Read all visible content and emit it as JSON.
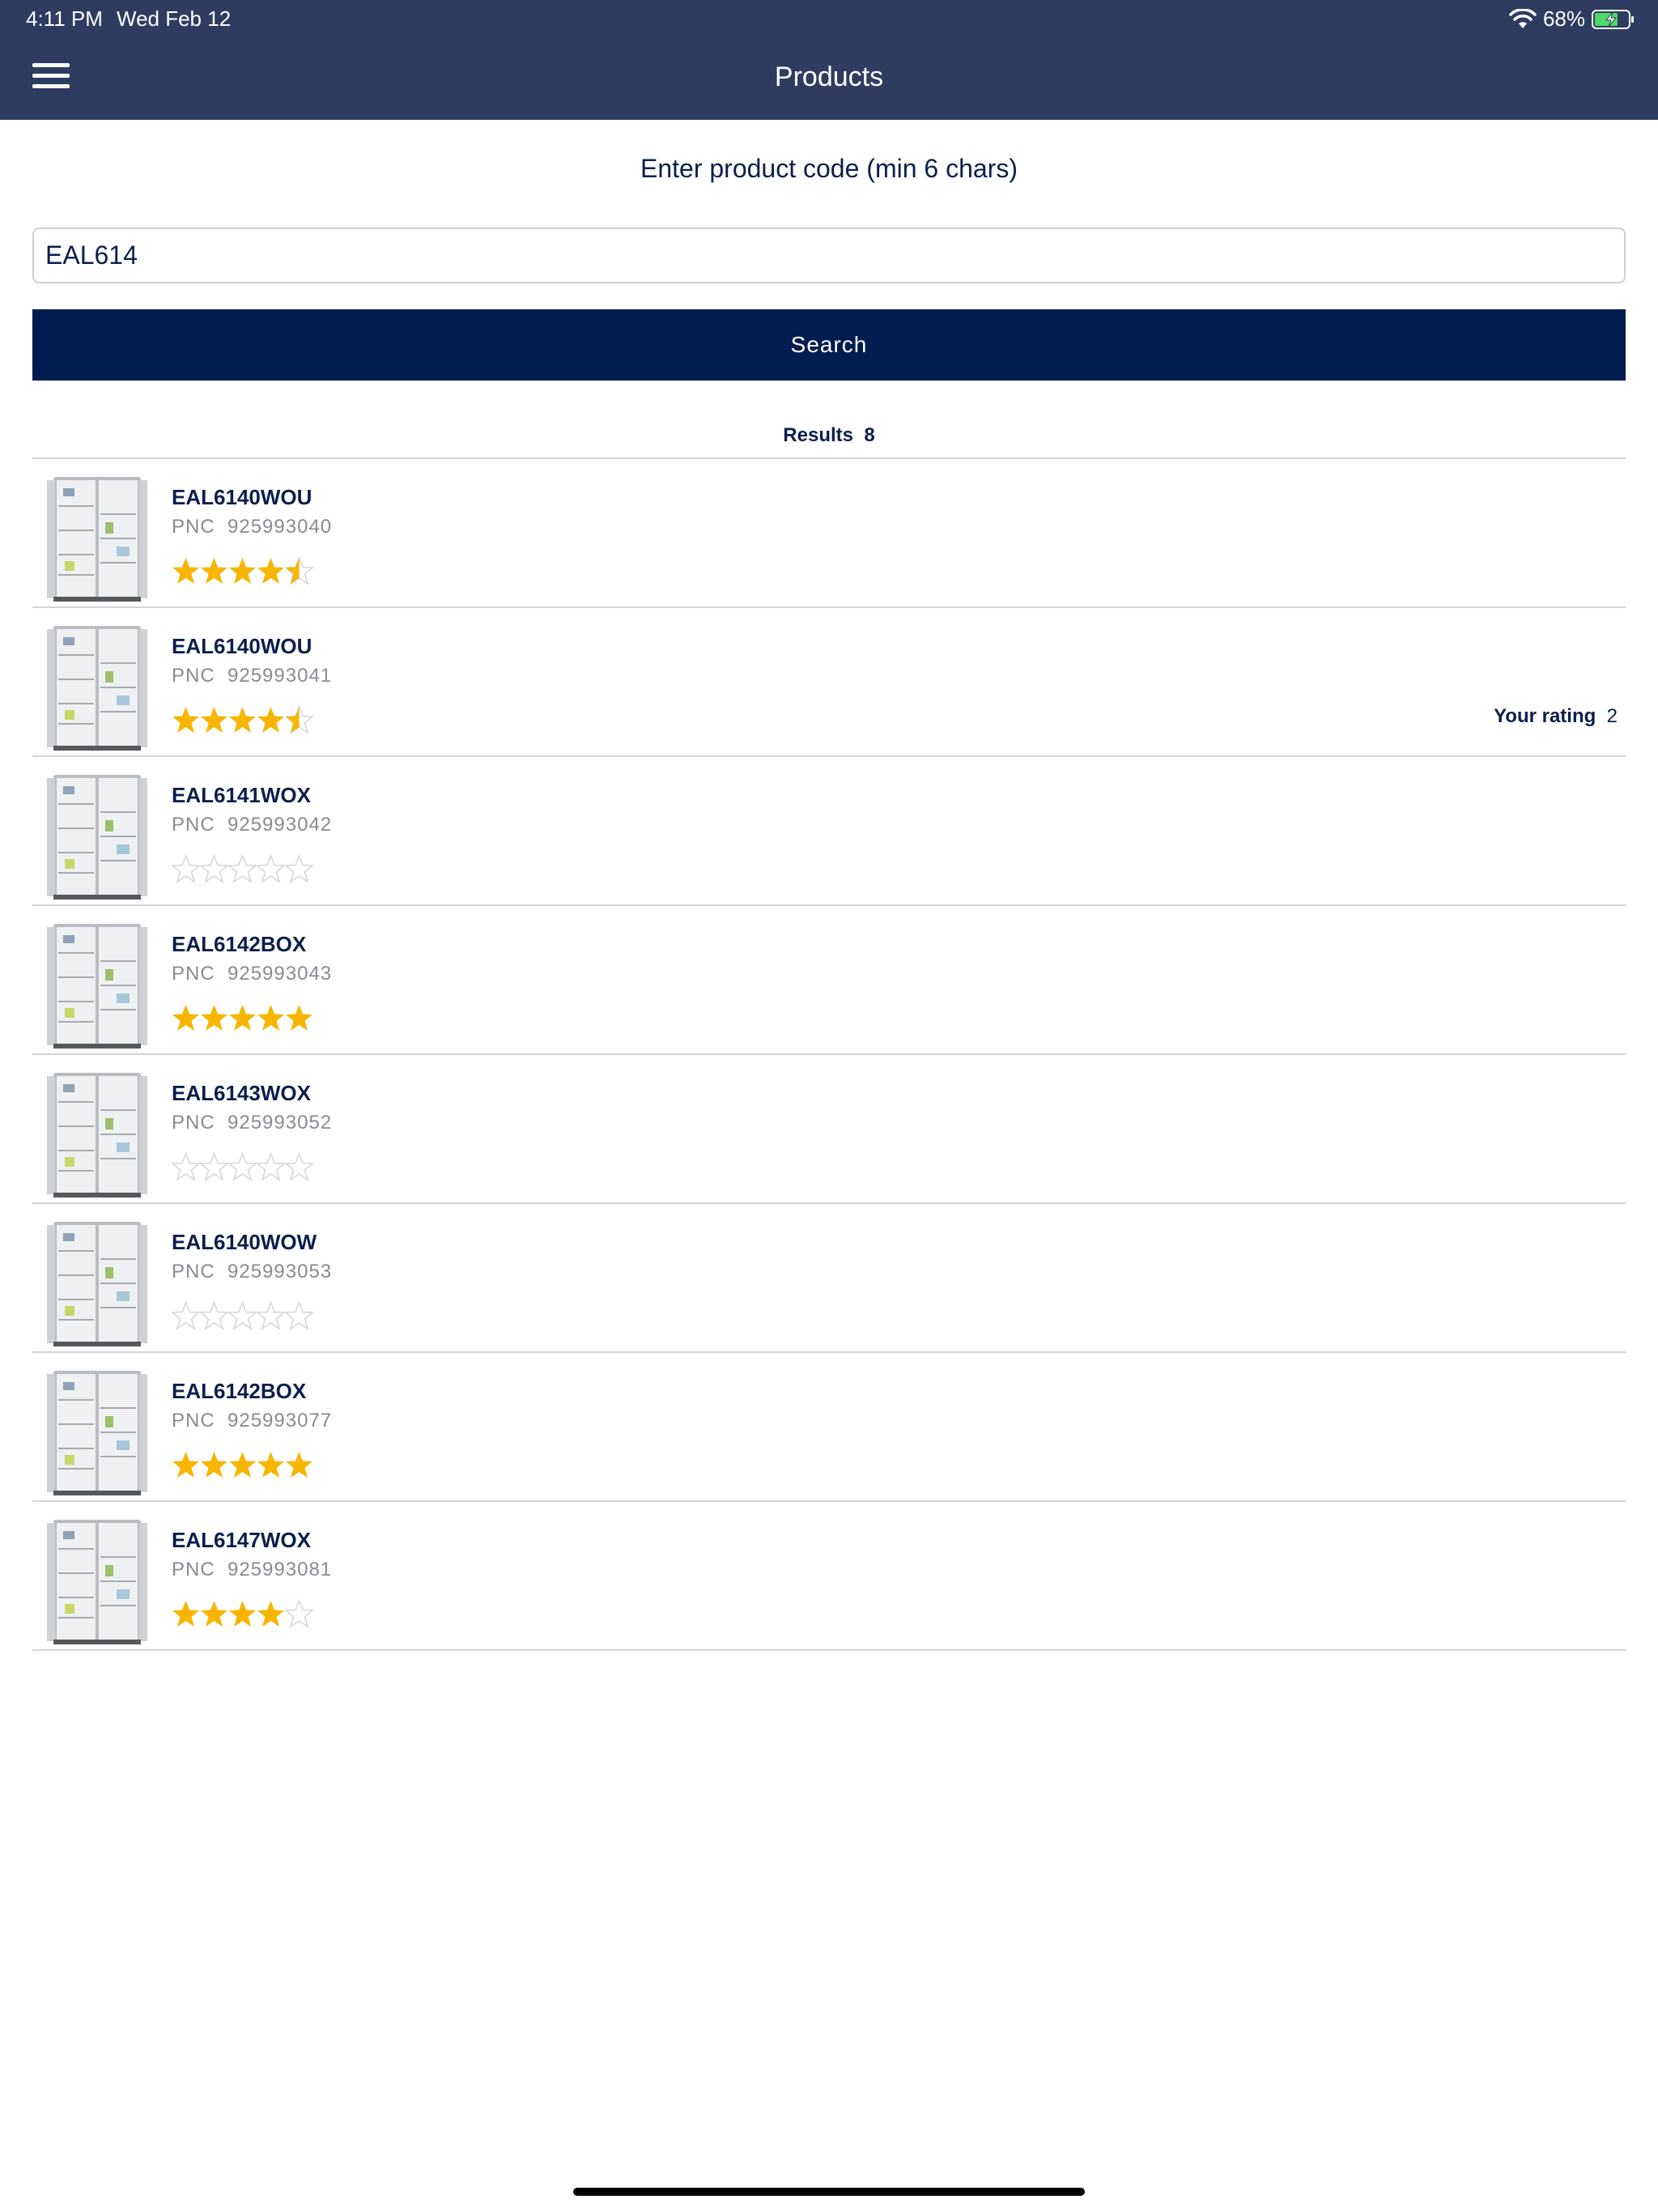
{
  "status_bar": {
    "time": "4:11 PM",
    "date": "Wed Feb 12",
    "battery": "68%"
  },
  "header": {
    "title": "Products"
  },
  "form": {
    "prompt": "Enter product code (min 6 chars)",
    "code_value": "EAL614",
    "search_label": "Search"
  },
  "results": {
    "label": "Results",
    "count": "8"
  },
  "products": [
    {
      "name": "EAL6140WOU",
      "pnc_label": "PNC",
      "pnc": "925993040",
      "rating": 4.5,
      "your_rating_label": "",
      "your_rating": ""
    },
    {
      "name": "EAL6140WOU",
      "pnc_label": "PNC",
      "pnc": "925993041",
      "rating": 4.5,
      "your_rating_label": "Your rating",
      "your_rating": "2"
    },
    {
      "name": "EAL6141WOX",
      "pnc_label": "PNC",
      "pnc": "925993042",
      "rating": 0,
      "your_rating_label": "",
      "your_rating": ""
    },
    {
      "name": "EAL6142BOX",
      "pnc_label": "PNC",
      "pnc": "925993043",
      "rating": 5,
      "your_rating_label": "",
      "your_rating": ""
    },
    {
      "name": "EAL6143WOX",
      "pnc_label": "PNC",
      "pnc": "925993052",
      "rating": 0,
      "your_rating_label": "",
      "your_rating": ""
    },
    {
      "name": "EAL6140WOW",
      "pnc_label": "PNC",
      "pnc": "925993053",
      "rating": 0,
      "your_rating_label": "",
      "your_rating": ""
    },
    {
      "name": "EAL6142BOX",
      "pnc_label": "PNC",
      "pnc": "925993077",
      "rating": 5,
      "your_rating_label": "",
      "your_rating": ""
    },
    {
      "name": "EAL6147WOX",
      "pnc_label": "PNC",
      "pnc": "925993081",
      "rating": 4,
      "your_rating_label": "",
      "your_rating": ""
    }
  ],
  "colors": {
    "header": "#2e3c60",
    "button": "#011c4e",
    "star": "#f7b500",
    "text": "#0b1f4d"
  },
  "icons": {
    "menu": "hamburger-menu-icon",
    "wifi": "wifi-icon",
    "battery": "battery-charging-icon",
    "star": "star-icon",
    "product": "fridge-thumbnail"
  }
}
